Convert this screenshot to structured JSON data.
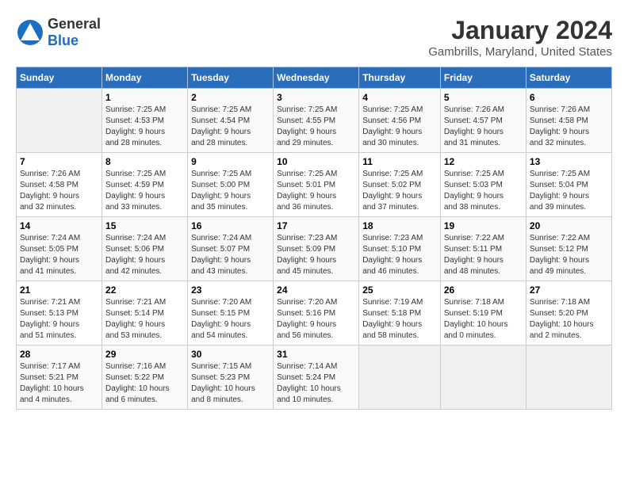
{
  "header": {
    "logo_general": "General",
    "logo_blue": "Blue",
    "title": "January 2024",
    "subtitle": "Gambrills, Maryland, United States"
  },
  "calendar": {
    "days_of_week": [
      "Sunday",
      "Monday",
      "Tuesday",
      "Wednesday",
      "Thursday",
      "Friday",
      "Saturday"
    ],
    "weeks": [
      [
        {
          "num": "",
          "info": "",
          "empty": true
        },
        {
          "num": "1",
          "info": "Sunrise: 7:25 AM\nSunset: 4:53 PM\nDaylight: 9 hours\nand 28 minutes."
        },
        {
          "num": "2",
          "info": "Sunrise: 7:25 AM\nSunset: 4:54 PM\nDaylight: 9 hours\nand 28 minutes."
        },
        {
          "num": "3",
          "info": "Sunrise: 7:25 AM\nSunset: 4:55 PM\nDaylight: 9 hours\nand 29 minutes."
        },
        {
          "num": "4",
          "info": "Sunrise: 7:25 AM\nSunset: 4:56 PM\nDaylight: 9 hours\nand 30 minutes."
        },
        {
          "num": "5",
          "info": "Sunrise: 7:26 AM\nSunset: 4:57 PM\nDaylight: 9 hours\nand 31 minutes."
        },
        {
          "num": "6",
          "info": "Sunrise: 7:26 AM\nSunset: 4:58 PM\nDaylight: 9 hours\nand 32 minutes."
        }
      ],
      [
        {
          "num": "7",
          "info": "Sunrise: 7:26 AM\nSunset: 4:58 PM\nDaylight: 9 hours\nand 32 minutes."
        },
        {
          "num": "8",
          "info": "Sunrise: 7:25 AM\nSunset: 4:59 PM\nDaylight: 9 hours\nand 33 minutes."
        },
        {
          "num": "9",
          "info": "Sunrise: 7:25 AM\nSunset: 5:00 PM\nDaylight: 9 hours\nand 35 minutes."
        },
        {
          "num": "10",
          "info": "Sunrise: 7:25 AM\nSunset: 5:01 PM\nDaylight: 9 hours\nand 36 minutes."
        },
        {
          "num": "11",
          "info": "Sunrise: 7:25 AM\nSunset: 5:02 PM\nDaylight: 9 hours\nand 37 minutes."
        },
        {
          "num": "12",
          "info": "Sunrise: 7:25 AM\nSunset: 5:03 PM\nDaylight: 9 hours\nand 38 minutes."
        },
        {
          "num": "13",
          "info": "Sunrise: 7:25 AM\nSunset: 5:04 PM\nDaylight: 9 hours\nand 39 minutes."
        }
      ],
      [
        {
          "num": "14",
          "info": "Sunrise: 7:24 AM\nSunset: 5:05 PM\nDaylight: 9 hours\nand 41 minutes."
        },
        {
          "num": "15",
          "info": "Sunrise: 7:24 AM\nSunset: 5:06 PM\nDaylight: 9 hours\nand 42 minutes."
        },
        {
          "num": "16",
          "info": "Sunrise: 7:24 AM\nSunset: 5:07 PM\nDaylight: 9 hours\nand 43 minutes."
        },
        {
          "num": "17",
          "info": "Sunrise: 7:23 AM\nSunset: 5:09 PM\nDaylight: 9 hours\nand 45 minutes."
        },
        {
          "num": "18",
          "info": "Sunrise: 7:23 AM\nSunset: 5:10 PM\nDaylight: 9 hours\nand 46 minutes."
        },
        {
          "num": "19",
          "info": "Sunrise: 7:22 AM\nSunset: 5:11 PM\nDaylight: 9 hours\nand 48 minutes."
        },
        {
          "num": "20",
          "info": "Sunrise: 7:22 AM\nSunset: 5:12 PM\nDaylight: 9 hours\nand 49 minutes."
        }
      ],
      [
        {
          "num": "21",
          "info": "Sunrise: 7:21 AM\nSunset: 5:13 PM\nDaylight: 9 hours\nand 51 minutes."
        },
        {
          "num": "22",
          "info": "Sunrise: 7:21 AM\nSunset: 5:14 PM\nDaylight: 9 hours\nand 53 minutes."
        },
        {
          "num": "23",
          "info": "Sunrise: 7:20 AM\nSunset: 5:15 PM\nDaylight: 9 hours\nand 54 minutes."
        },
        {
          "num": "24",
          "info": "Sunrise: 7:20 AM\nSunset: 5:16 PM\nDaylight: 9 hours\nand 56 minutes."
        },
        {
          "num": "25",
          "info": "Sunrise: 7:19 AM\nSunset: 5:18 PM\nDaylight: 9 hours\nand 58 minutes."
        },
        {
          "num": "26",
          "info": "Sunrise: 7:18 AM\nSunset: 5:19 PM\nDaylight: 10 hours\nand 0 minutes."
        },
        {
          "num": "27",
          "info": "Sunrise: 7:18 AM\nSunset: 5:20 PM\nDaylight: 10 hours\nand 2 minutes."
        }
      ],
      [
        {
          "num": "28",
          "info": "Sunrise: 7:17 AM\nSunset: 5:21 PM\nDaylight: 10 hours\nand 4 minutes."
        },
        {
          "num": "29",
          "info": "Sunrise: 7:16 AM\nSunset: 5:22 PM\nDaylight: 10 hours\nand 6 minutes."
        },
        {
          "num": "30",
          "info": "Sunrise: 7:15 AM\nSunset: 5:23 PM\nDaylight: 10 hours\nand 8 minutes."
        },
        {
          "num": "31",
          "info": "Sunrise: 7:14 AM\nSunset: 5:24 PM\nDaylight: 10 hours\nand 10 minutes."
        },
        {
          "num": "",
          "info": "",
          "empty": true
        },
        {
          "num": "",
          "info": "",
          "empty": true
        },
        {
          "num": "",
          "info": "",
          "empty": true
        }
      ]
    ]
  }
}
